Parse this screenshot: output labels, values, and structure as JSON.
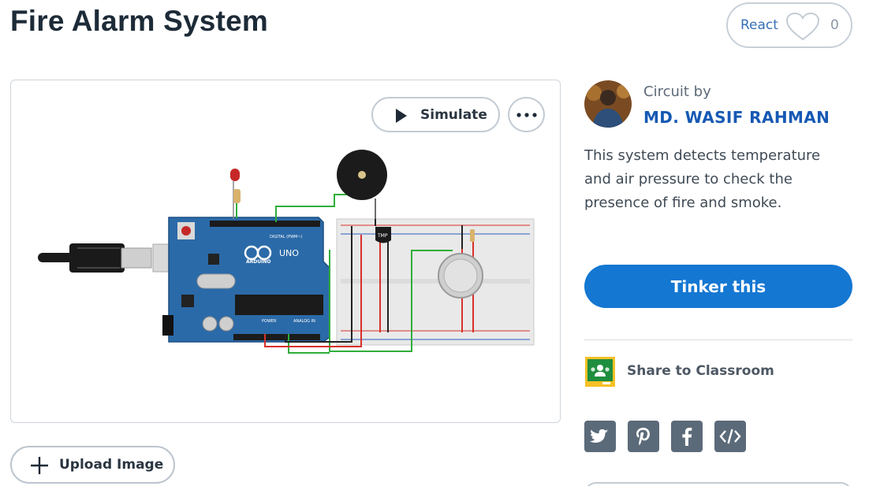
{
  "page": {
    "title": "Fire Alarm System"
  },
  "react": {
    "label": "React",
    "count": "0"
  },
  "viewer": {
    "simulate_label": "Simulate",
    "more_icon": "ellipsis-icon",
    "circuit": {
      "board_brand": "ARDUINO",
      "board_model": "UNO",
      "board_digital_label": "DIGITAL (PWM~)",
      "board_power_label": "POWER",
      "board_analog_label": "ANALOG IN",
      "sensor_label": "TMP",
      "board_color": "#2b6aa8",
      "wire_green": "#2fae3a",
      "wire_red": "#d8302a",
      "wire_black": "#222222"
    }
  },
  "upload": {
    "label": "Upload Image",
    "icon": "plus-icon"
  },
  "author": {
    "kicker": "Circuit by",
    "name": "MD. WASIF RAHMAN"
  },
  "description": "This system detects temperature and air pressure to check the presence of fire and smoke.",
  "actions": {
    "tinker_label": "Tinker this",
    "classroom_label": "Share to Classroom"
  },
  "share": {
    "icons": [
      "twitter-icon",
      "pinterest-icon",
      "facebook-icon",
      "embed-icon"
    ]
  },
  "colors": {
    "accent": "#1477d2",
    "author_link": "#1659b4",
    "social_bg": "#5b6a79",
    "classroom_green": "#1e8e3e",
    "classroom_yellow": "#f6c026"
  }
}
